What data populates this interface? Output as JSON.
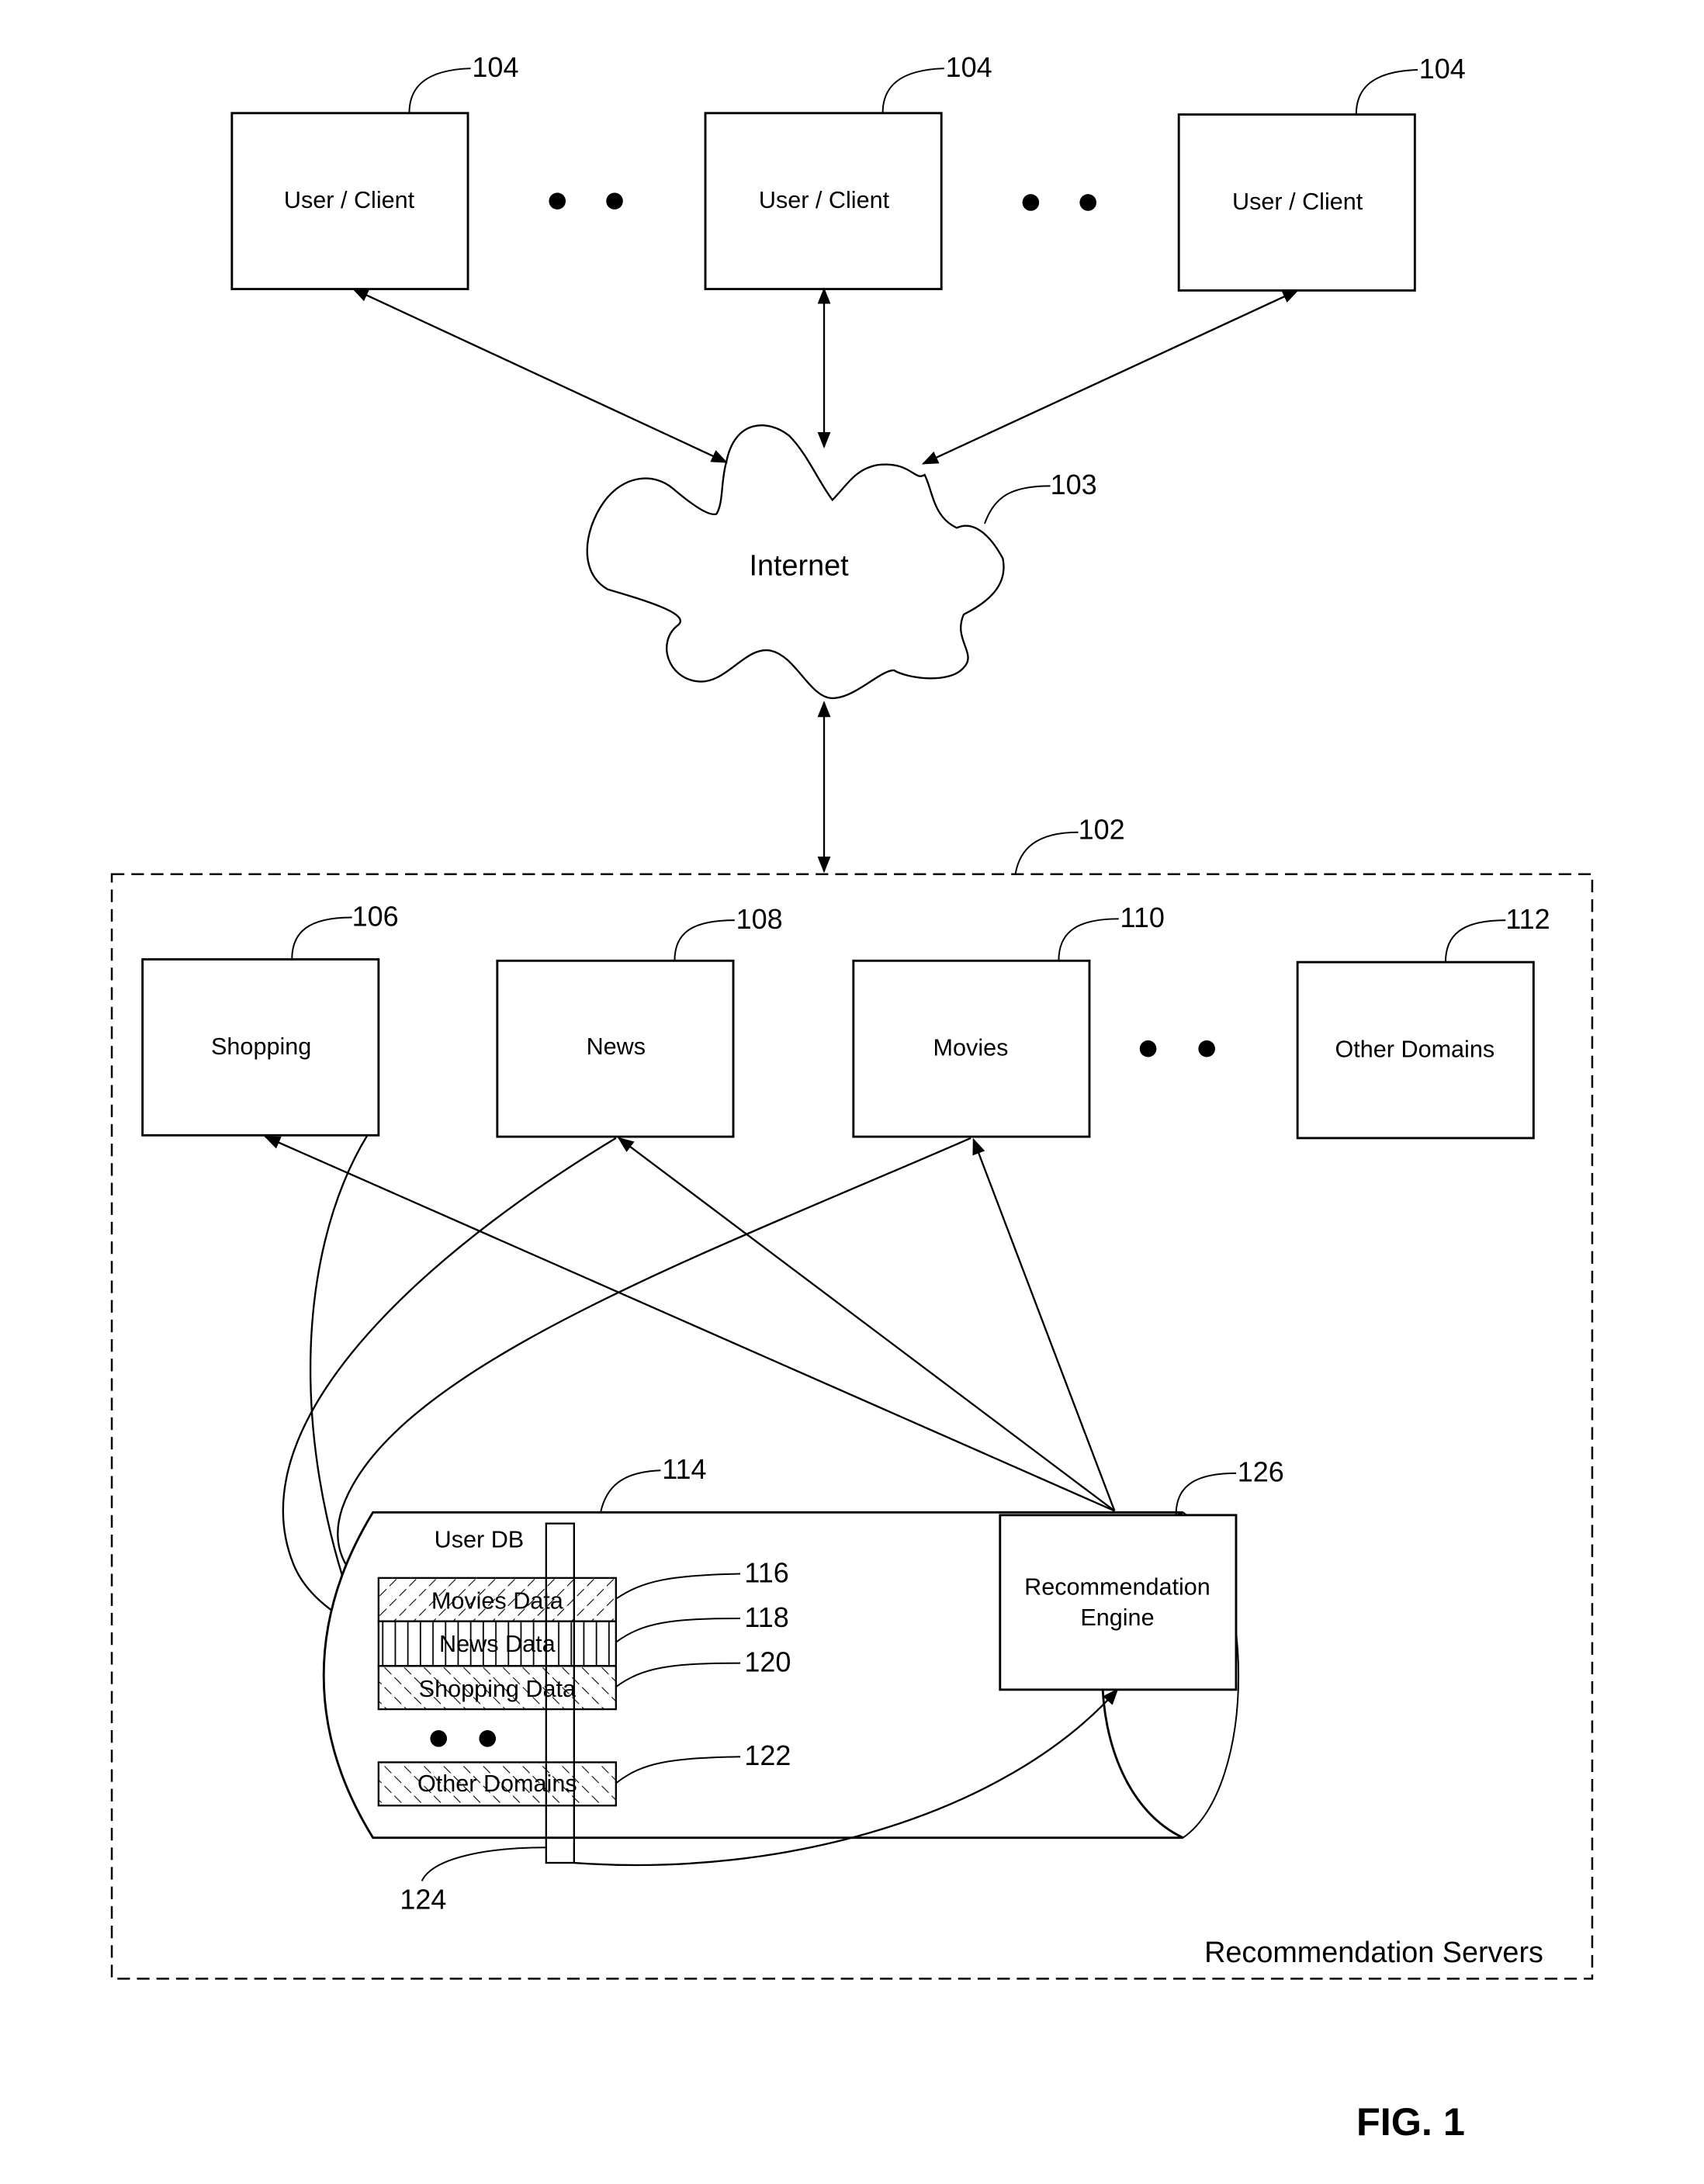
{
  "figure_label": "FIG. 1",
  "clients": [
    {
      "label": "User / Client",
      "ref": "104"
    },
    {
      "label": "User / Client",
      "ref": "104"
    },
    {
      "label": "User / Client",
      "ref": "104"
    }
  ],
  "internet": {
    "label": "Internet",
    "ref": "103"
  },
  "servers": {
    "label": "Recommendation Servers",
    "ref": "102"
  },
  "domains": [
    {
      "label": "Shopping",
      "ref": "106"
    },
    {
      "label": "News",
      "ref": "108"
    },
    {
      "label": "Movies",
      "ref": "110"
    },
    {
      "label": "Other Domains",
      "ref": "112"
    }
  ],
  "user_db": {
    "label": "User DB",
    "ref": "114",
    "rows": [
      {
        "label": "Movies Data",
        "ref": "116"
      },
      {
        "label": "News Data",
        "ref": "118"
      },
      {
        "label": "Shopping Data",
        "ref": "120"
      },
      {
        "label": "Other Domains",
        "ref": "122"
      }
    ],
    "column_ref": "124"
  },
  "engine": {
    "label_line1": "Recommendation",
    "label_line2": "Engine",
    "ref": "126"
  }
}
